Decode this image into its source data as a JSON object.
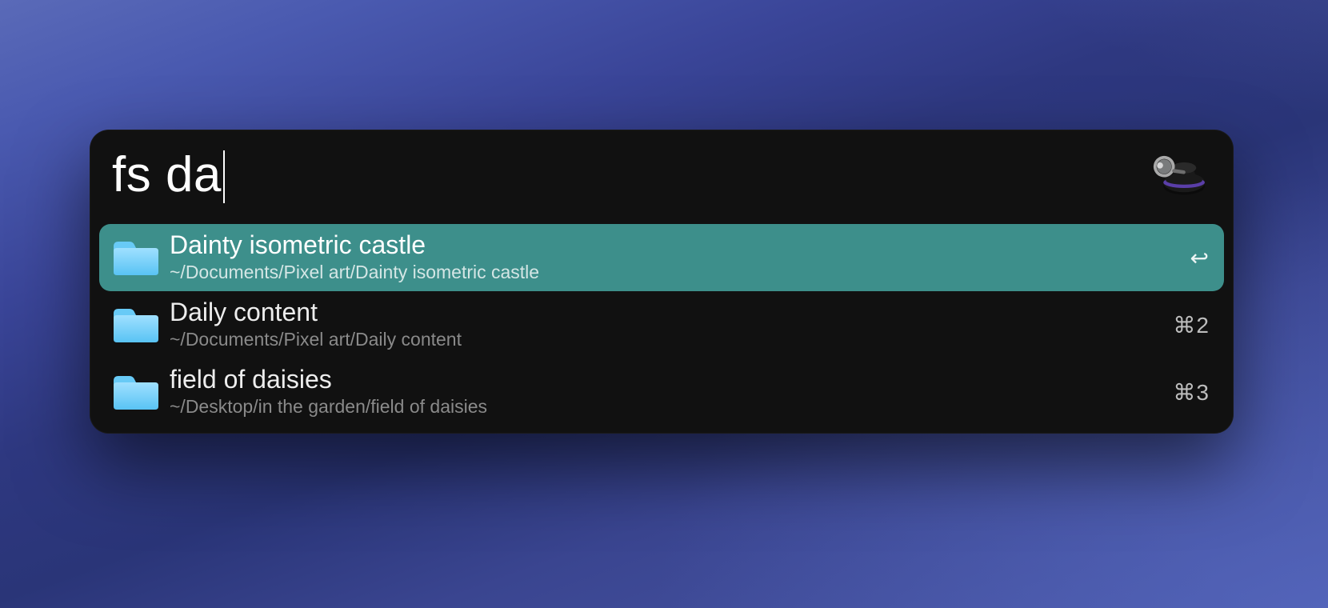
{
  "search": {
    "query": "fs da"
  },
  "results": [
    {
      "title": "Dainty isometric castle",
      "path": "~/Documents/Pixel art/Dainty isometric castle",
      "shortcut": "↩",
      "selected": true
    },
    {
      "title": "Daily content",
      "path": "~/Documents/Pixel art/Daily content",
      "shortcut": "⌘2",
      "selected": false
    },
    {
      "title": "field of daisies",
      "path": "~/Desktop/in the garden/field of daisies",
      "shortcut": "⌘3",
      "selected": false
    }
  ],
  "colors": {
    "panel_bg": "#111111",
    "selected_bg": "#3d8f8b",
    "folder_fill_top": "#8fd9ff",
    "folder_fill_bottom": "#5ec5f7"
  },
  "app_icon_name": "alfred-icon"
}
